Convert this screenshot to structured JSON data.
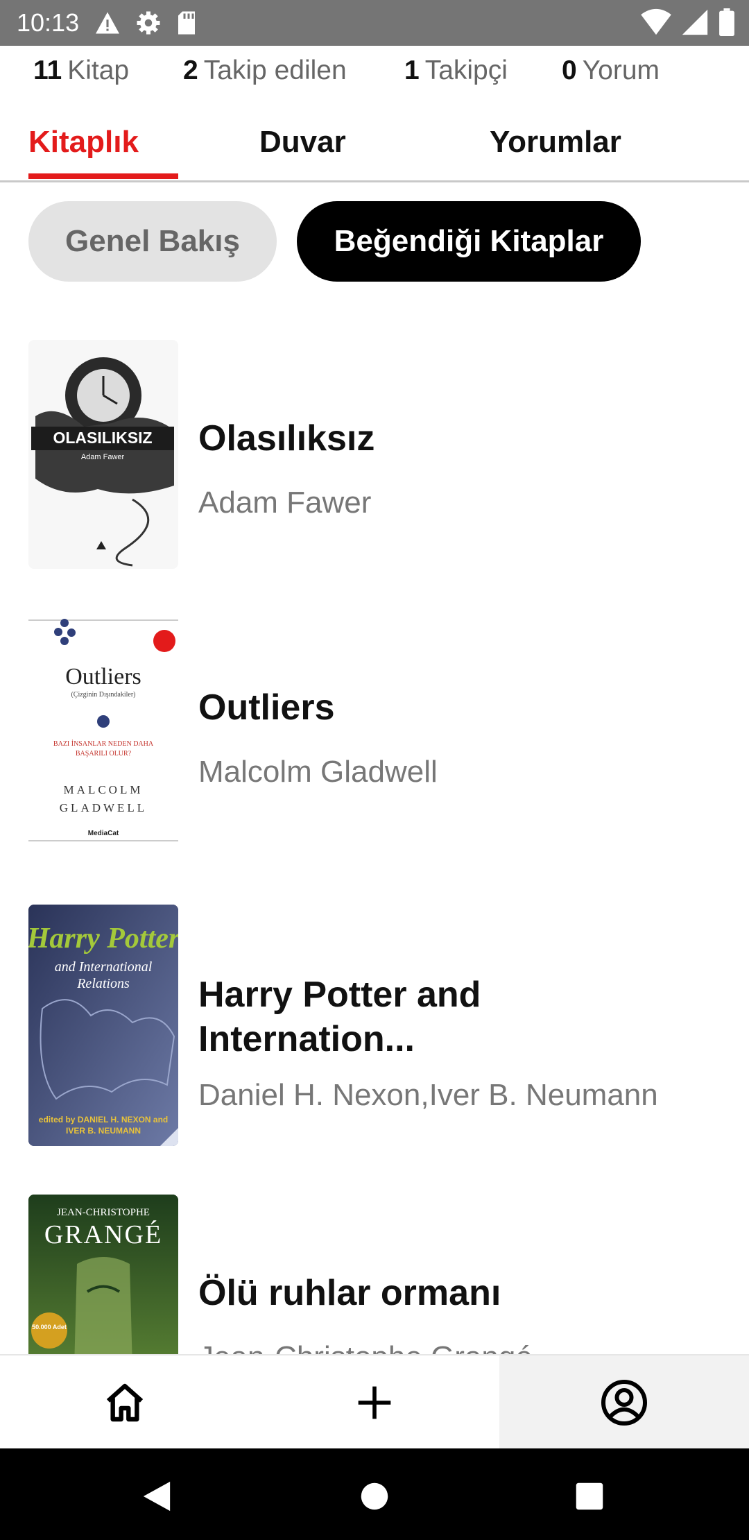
{
  "status_bar": {
    "time": "10:13",
    "left_icons": [
      "warning-icon",
      "settings-icon",
      "sd-card-icon"
    ],
    "right_icons": [
      "wifi-icon",
      "signal-icon",
      "battery-icon"
    ]
  },
  "stats": [
    {
      "count": "11",
      "label": "Kitap"
    },
    {
      "count": "2",
      "label": "Takip edilen"
    },
    {
      "count": "1",
      "label": "Takipçi"
    },
    {
      "count": "0",
      "label": "Yorum"
    }
  ],
  "tabs": [
    {
      "label": "Kitaplık",
      "active": true
    },
    {
      "label": "Duvar",
      "active": false
    },
    {
      "label": "Yorumlar",
      "active": false
    }
  ],
  "filters": {
    "overview": "Genel Bakış",
    "liked_books": "Beğendiği Kitaplar",
    "selected": "liked_books"
  },
  "books": [
    {
      "title": "Olasılıksız",
      "author": "Adam Fawer",
      "cover_text": "OLASILIKSIZ",
      "cover_subtext": "Adam Fawer"
    },
    {
      "title": "Outliers",
      "author": "Malcolm Gladwell",
      "cover_text": "Outliers",
      "cover_subtext": "(Çizginin Dışındakiler)",
      "cover_tagline": "BAZI İNSANLAR NEDEN DAHA BAŞARILI OLUR?",
      "cover_author": "MALCOLM GLADWELL",
      "cover_publisher": "MediaCat"
    },
    {
      "title": "Harry Potter and Internation...",
      "author": "Daniel H. Nexon,Iver B. Neumann",
      "cover_text": "Harry Potter",
      "cover_subtext": "and International Relations",
      "cover_editors": "edited by DANIEL H. NEXON and IVER B. NEUMANN"
    },
    {
      "title": "Ölü ruhlar ormanı",
      "author": "Jean-Christophe Grangé",
      "cover_text": "GRANGÉ",
      "cover_subtext": "JEAN-CHRISTOPHE",
      "cover_badge": "50.000 Adet"
    }
  ],
  "bottom_nav": {
    "items": [
      "home-icon",
      "add-icon",
      "profile-icon"
    ],
    "selected": "profile-icon"
  },
  "colors": {
    "accent": "#e31b1b",
    "status_bar": "#757575",
    "active_pill": "#000000",
    "inactive_pill": "#e3e3e3",
    "author_text": "#777777"
  }
}
